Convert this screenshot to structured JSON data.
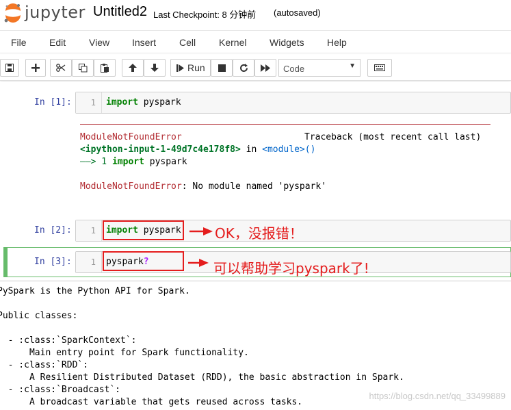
{
  "header": {
    "logo_text": "jupyter",
    "notebook_title": "Untitled2",
    "checkpoint": "Last Checkpoint: 8 分钟前",
    "autosaved": "(autosaved)"
  },
  "menu": [
    "File",
    "Edit",
    "View",
    "Insert",
    "Cell",
    "Kernel",
    "Widgets",
    "Help"
  ],
  "toolbar": {
    "run_label": "Run",
    "cell_type": "Code",
    "icons": [
      "save-icon",
      "plus-icon",
      "cut-icon",
      "copy-icon",
      "paste-icon",
      "arrow-up-icon",
      "arrow-down-icon",
      "step-forward-icon",
      "stop-icon",
      "restart-icon",
      "fast-forward-icon",
      "keyboard-icon"
    ]
  },
  "cells": [
    {
      "prompt": "In [1]:",
      "line": "1",
      "kw": "import",
      "rest": " pyspark"
    },
    {
      "prompt": "In [2]:",
      "line": "1",
      "kw": "import",
      "rest": " pyspark"
    },
    {
      "prompt": "In [3]:",
      "line": "1",
      "kw": "",
      "rest": "pyspark",
      "suffix": "?"
    }
  ],
  "error": {
    "name": "ModuleNotFoundError",
    "traceback": "Traceback (most recent call last)",
    "location": "<ipython-input-1-49d7c4e178f8>",
    "in": " in ",
    "module": "<module>",
    "parens": "()",
    "arrow": "——> 1 ",
    "arrow_kw": "import",
    "arrow_rest": " pyspark",
    "message": ": No module named 'pyspark'"
  },
  "annotations": {
    "ok": "OK，没报错！",
    "help": "可以帮助学习pyspark了!"
  },
  "pager": {
    "text": "PySpark is the Python API for Spark.\n\nPublic classes:\n\n  - :class:`SparkContext`:\n      Main entry point for Spark functionality.\n  - :class:`RDD`:\n      A Resilient Distributed Dataset (RDD), the basic abstraction in Spark.\n  - :class:`Broadcast`:\n      A broadcast variable that gets reused across tasks."
  },
  "watermark": "https://blog.csdn.net/qq_33499889",
  "colors": {
    "accent_green": "#66bb6a",
    "annotation_red": "#e41d1d",
    "prompt_blue": "#303f9f",
    "error_red": "#b22b31"
  }
}
